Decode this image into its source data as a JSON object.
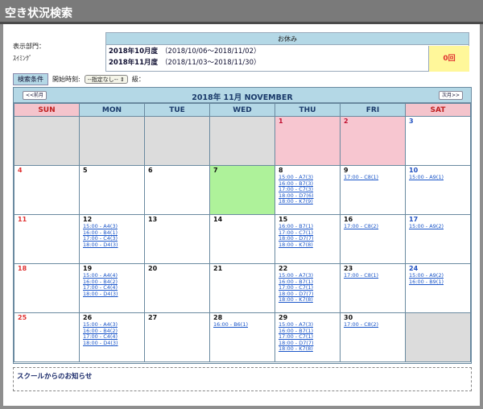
{
  "header": {
    "title": "空き状況検索"
  },
  "dept": {
    "label": "表示部門：",
    "value": "ｽｲﾐﾝｸﾞ"
  },
  "holidays": {
    "header": "お休み",
    "rows": [
      {
        "label": "2018年10月度",
        "range": "（2018/10/06～2018/11/02）"
      },
      {
        "label": "2018年11月度",
        "range": "（2018/11/03～2018/11/30）"
      }
    ],
    "count": "0回"
  },
  "conditions": {
    "tag": "検索条件",
    "start_label": "開始時刻:",
    "select_value": "--指定なし--",
    "level_label": "級："
  },
  "calendar": {
    "title": "2018年 11月 NOVEMBER",
    "prev": "<<前月",
    "next": "次月>>",
    "weekdays": [
      "SUN",
      "MON",
      "TUE",
      "WED",
      "THU",
      "FRI",
      "SAT"
    ],
    "weeks": [
      [
        {
          "day": "",
          "state": "gray"
        },
        {
          "day": "",
          "state": "gray"
        },
        {
          "day": "",
          "state": "gray"
        },
        {
          "day": "",
          "state": "gray"
        },
        {
          "day": "1",
          "state": "pink",
          "slots": []
        },
        {
          "day": "2",
          "state": "pink",
          "slots": []
        },
        {
          "day": "3",
          "state": "normal",
          "slots": []
        }
      ],
      [
        {
          "day": "4",
          "slots": []
        },
        {
          "day": "5",
          "slots": []
        },
        {
          "day": "6",
          "slots": []
        },
        {
          "day": "7",
          "state": "green",
          "slots": []
        },
        {
          "day": "8",
          "slots": [
            "15:00 - A7(3)",
            "16:00 - B7(3)",
            "17:00 - C7(3)",
            "18:00 - D7(6)",
            "18:00 - K7(9)"
          ]
        },
        {
          "day": "9",
          "slots": [
            "17:00 - C8(1)"
          ]
        },
        {
          "day": "10",
          "slots": [
            "15:00 - A9(1)"
          ]
        }
      ],
      [
        {
          "day": "11",
          "slots": []
        },
        {
          "day": "12",
          "slots": [
            "15:00 - A4(3)",
            "16:00 - B4(1)",
            "17:00 - C4(3)",
            "18:00 - D4(3)"
          ]
        },
        {
          "day": "13",
          "slots": []
        },
        {
          "day": "14",
          "slots": []
        },
        {
          "day": "15",
          "slots": [
            "16:00 - B7(1)",
            "17:00 - C7(1)",
            "18:00 - D7(7)",
            "18:00 - K7(8)"
          ]
        },
        {
          "day": "16",
          "slots": [
            "17:00 - C8(2)"
          ]
        },
        {
          "day": "17",
          "slots": [
            "15:00 - A9(2)"
          ]
        }
      ],
      [
        {
          "day": "18",
          "slots": []
        },
        {
          "day": "19",
          "slots": [
            "15:00 - A4(4)",
            "16:00 - B4(2)",
            "17:00 - C4(4)",
            "18:00 - D4(3)"
          ]
        },
        {
          "day": "20",
          "slots": []
        },
        {
          "day": "21",
          "slots": []
        },
        {
          "day": "22",
          "slots": [
            "15:00 - A7(3)",
            "16:00 - B7(1)",
            "17:00 - C7(1)",
            "18:00 - D7(7)",
            "18:00 - K7(8)"
          ]
        },
        {
          "day": "23",
          "slots": [
            "17:00 - C8(1)"
          ]
        },
        {
          "day": "24",
          "slots": [
            "15:00 - A9(2)",
            "16:00 - B9(1)"
          ]
        }
      ],
      [
        {
          "day": "25",
          "slots": []
        },
        {
          "day": "26",
          "slots": [
            "15:00 - A4(3)",
            "16:00 - B4(2)",
            "17:00 - C4(4)",
            "18:00 - D4(3)"
          ]
        },
        {
          "day": "27",
          "slots": []
        },
        {
          "day": "28",
          "slots": [
            "16:00 - B6(1)"
          ]
        },
        {
          "day": "29",
          "slots": [
            "15:00 - A7(3)",
            "16:00 - B7(1)",
            "17:00 - C7(1)",
            "18:00 - D7(7)",
            "18:00 - K7(8)"
          ]
        },
        {
          "day": "30",
          "slots": [
            "17:00 - C8(2)"
          ]
        },
        {
          "day": "",
          "state": "gray"
        }
      ]
    ]
  },
  "notice": {
    "title": "スクールからのお知らせ"
  },
  "colors": {
    "header_bg": "#7a7a7a",
    "accent": "#b4d8e6",
    "holiday_pink": "#f7c6d0",
    "today_green": "#aef29a",
    "link": "#1a55c8",
    "count_bg": "#fff79a"
  }
}
